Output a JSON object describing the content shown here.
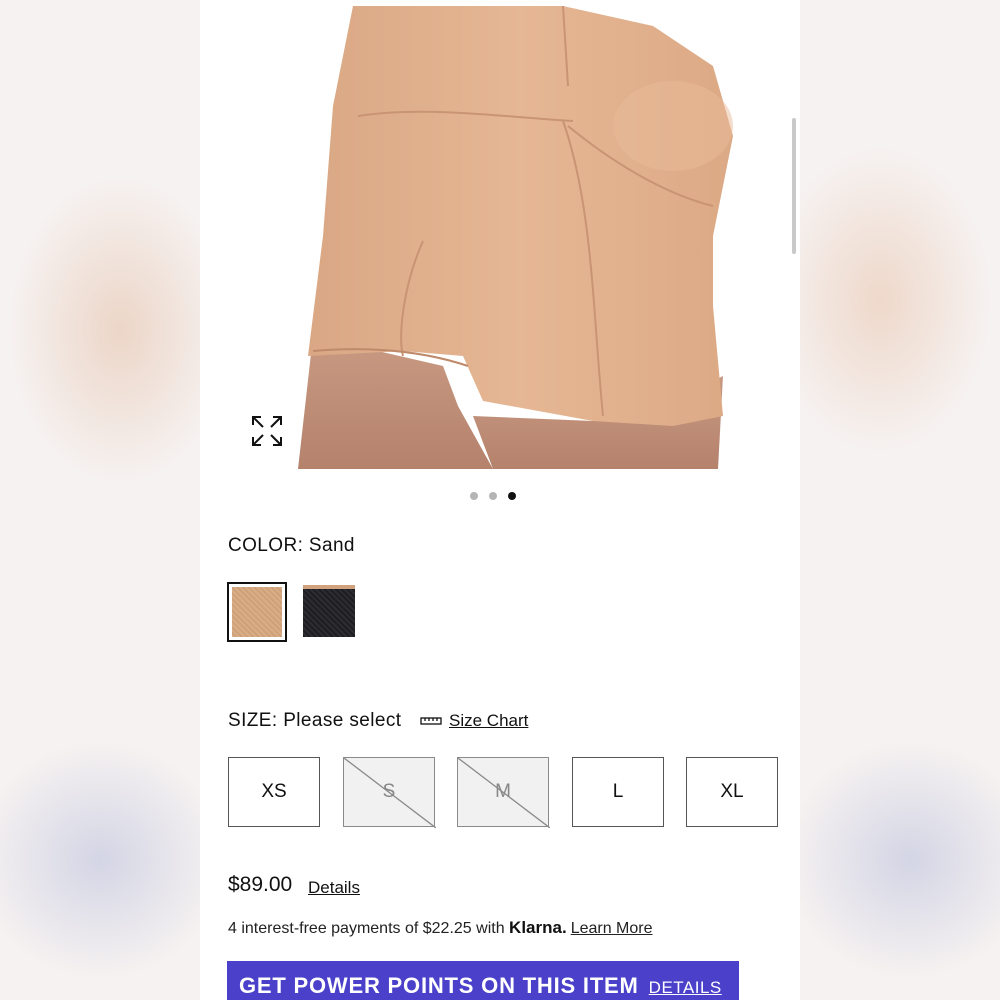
{
  "colors": {
    "accent_banner": "#4a40c9",
    "swatch_sand": "#d4a680",
    "swatch_black": "#222226"
  },
  "gallery": {
    "total_images": 3,
    "active_index": 3,
    "expand_icon": "expand-icon"
  },
  "color": {
    "label": "COLOR: Sand",
    "selected": "Sand"
  },
  "size": {
    "label": "SIZE: Please select",
    "size_chart_link": "Size Chart",
    "size_chart_icon": "ruler-icon",
    "options": [
      {
        "label": "XS",
        "available": true
      },
      {
        "label": "S",
        "available": false
      },
      {
        "label": "M",
        "available": false
      },
      {
        "label": "L",
        "available": true
      },
      {
        "label": "XL",
        "available": true
      }
    ]
  },
  "price": {
    "amount": "$89.00",
    "details_link": "Details"
  },
  "klarna": {
    "text": "4 interest-free payments of $22.25 with ",
    "brand": "Klarna.",
    "learn_more": "Learn More"
  },
  "power_points": {
    "text": "GET POWER POINTS ON THIS ITEM",
    "details_link": "DETAILS"
  }
}
